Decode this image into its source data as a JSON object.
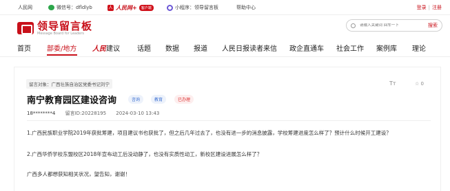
{
  "topbar": {
    "site": "人民网",
    "wechat": "微信号：dfldlyb",
    "app_brand": "人民网+",
    "app_badge": "客户端",
    "miniprogram": "小程序：领导留言板",
    "help": "帮助中心",
    "login": "登录",
    "register": "注册"
  },
  "header": {
    "logo_cn": "领导留言板",
    "logo_en": "Message Board for Leaders",
    "search_placeholder": "请输入关键词 回车一下",
    "search_button": "搜索"
  },
  "nav": {
    "items": [
      "首页",
      "部委/地方",
      "建议",
      "话题",
      "数据",
      "报道",
      "人民日报读者来信",
      "政企直通车",
      "社会工作",
      "案例库",
      "理论"
    ],
    "brand_prefix": "人民"
  },
  "message": {
    "target": "留言对象：广西壮族自治区党委书记刘宁",
    "title": "南宁教育园区建设咨询",
    "tags": [
      "咨询",
      "教育",
      "已办理"
    ],
    "user": "18********4",
    "id": "留言ID:20228195",
    "date": "2024-03-10 13:43",
    "font_icon": "Tт",
    "fav": "☆ 0",
    "paragraphs": [
      "1.广西民族职业学院2019年获批筹建，项目建议书也获批了，但之后几年过去了，也没有进一步的消息披露，学校筹建进度怎么样了？预计什么时候开工建设？",
      "2.广西华侨学校东盟校区2018年宣布动工后没动静了，也没有实质性动工，新校区建设进展怎么样了？",
      "广西多人都想获知相关状况，望告知，谢谢！"
    ]
  }
}
